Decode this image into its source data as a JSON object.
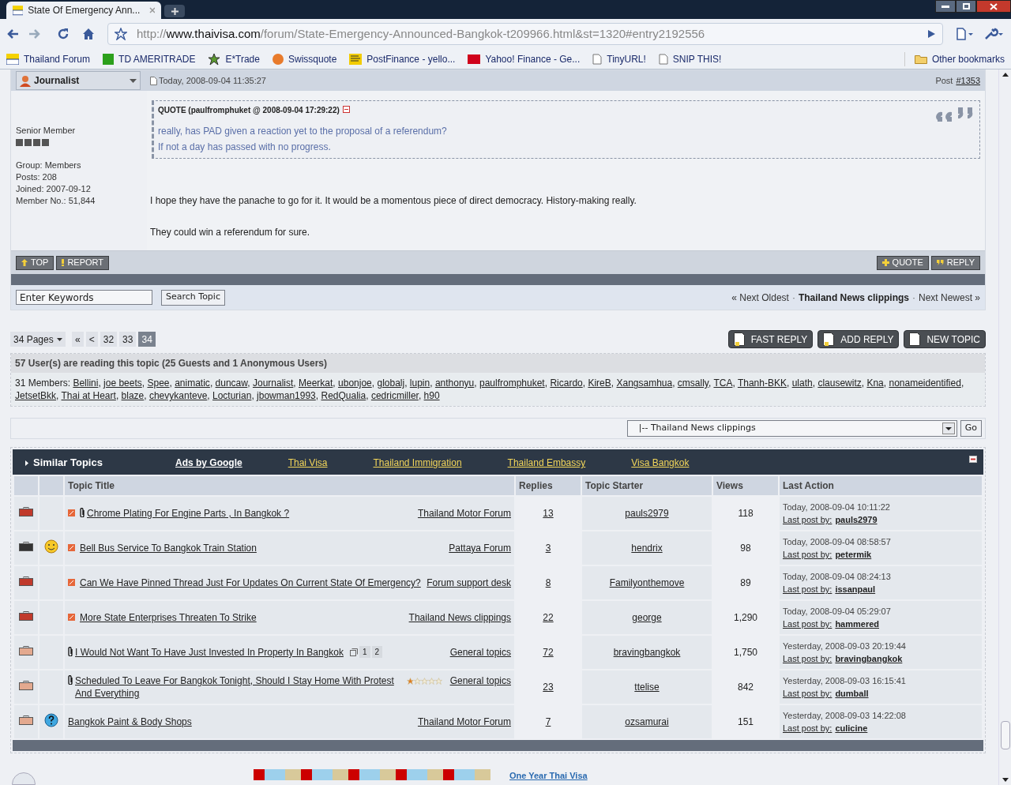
{
  "browser": {
    "tab_title": "State Of Emergency Ann...",
    "url": {
      "scheme": "http://",
      "host": "www.thaivisa.com",
      "path": "/forum/State-Emergency-Announced-Bangkok-t209966.html&st=1320#entry2192556"
    },
    "bookmarks": [
      {
        "label": "Thailand Forum",
        "kind": "flag"
      },
      {
        "label": "TD AMERITRADE",
        "kind": "td"
      },
      {
        "label": "E*Trade",
        "kind": "etrade"
      },
      {
        "label": "Swissquote",
        "kind": "swiss"
      },
      {
        "label": "PostFinance - yello...",
        "kind": "post"
      },
      {
        "label": "Yahoo! Finance - Ge...",
        "kind": "yahoo"
      },
      {
        "label": "TinyURL!",
        "kind": "page"
      },
      {
        "label": "SNIP THIS!",
        "kind": "page"
      }
    ],
    "other_bookmarks": "Other bookmarks"
  },
  "post": {
    "author": "Journalist",
    "date": "Today, 2008-09-04 11:35:27",
    "post_label": "Post",
    "post_number": "#1353",
    "member": {
      "rank": "Senior Member",
      "details": [
        "Group: Members",
        "Posts: 208",
        "Joined: 2007-09-12",
        "Member No.: 51,844"
      ]
    },
    "quote": {
      "header": "QUOTE (paulfromphuket @ 2008-09-04 17:29:22)",
      "lines": [
        "really, has PAD given a reaction yet to the proposal of a referendum?",
        "If not a day has passed with no progress."
      ]
    },
    "body": [
      "I hope they have the panache to go for it. It would be a momentous piece of direct democracy. History-making really.",
      "They could win a referendum for sure."
    ],
    "left_buttons": [
      "TOP",
      "REPORT"
    ],
    "right_buttons": [
      "QUOTE",
      "REPLY"
    ]
  },
  "search": {
    "value": "Enter Keywords",
    "button": "Search Topic"
  },
  "topic_nav": {
    "prev": "« Next Oldest",
    "separator_1": "·",
    "forum": "Thailand News clippings",
    "separator_2": "·",
    "next": "Next Newest »"
  },
  "pagination": {
    "label": "34 Pages",
    "items": [
      {
        "label": "«",
        "selected": false
      },
      {
        "label": "<",
        "selected": false
      },
      {
        "label": "32",
        "selected": false
      },
      {
        "label": "33",
        "selected": false
      },
      {
        "label": "34",
        "selected": true
      }
    ]
  },
  "action_buttons": [
    "FAST REPLY",
    "ADD REPLY",
    "NEW TOPIC"
  ],
  "readers": {
    "heading": "57 User(s) are reading this topic (25 Guests and 1 Anonymous Users)",
    "members_label": "31 Members:",
    "members": [
      {
        "name": "Bellini",
        "sep": ","
      },
      {
        "name": "joe beets",
        "sep": ","
      },
      {
        "name": "Spee",
        "sep": ","
      },
      {
        "name": "animatic",
        "sep": ","
      },
      {
        "name": "duncaw",
        "sep": ","
      },
      {
        "name": "Journalist",
        "sep": ","
      },
      {
        "name": "Meerkat",
        "sep": ","
      },
      {
        "name": "ubonjoe",
        "sep": ","
      },
      {
        "name": "globalj",
        "sep": ","
      },
      {
        "name": "lupin",
        "sep": ","
      },
      {
        "name": "anthonyu",
        "sep": ","
      },
      {
        "name": "paulfromphuket",
        "sep": ","
      },
      {
        "name": "Ricardo",
        "sep": ","
      },
      {
        "name": "KireB",
        "sep": ","
      },
      {
        "name": "Xangsamhua",
        "sep": ","
      },
      {
        "name": "cmsally",
        "sep": ","
      },
      {
        "name": "TCA",
        "sep": ","
      },
      {
        "name": "Thanh-BKK",
        "sep": ","
      },
      {
        "name": "ulath",
        "sep": ","
      },
      {
        "name": "clausewitz",
        "sep": ","
      },
      {
        "name": "Kna",
        "sep": ","
      },
      {
        "name": "nonameidentified",
        "sep": ","
      },
      {
        "name": "JetsetBkk",
        "sep": ","
      },
      {
        "name": "Thai at Heart",
        "sep": ","
      },
      {
        "name": "blaze",
        "sep": ","
      },
      {
        "name": "chevykanteve",
        "sep": ","
      },
      {
        "name": "Locturian",
        "sep": ","
      },
      {
        "name": "jbowman1993",
        "sep": ","
      },
      {
        "name": "RedQualia",
        "sep": ","
      },
      {
        "name": "cedricmiller",
        "sep": ","
      },
      {
        "name": "h90"
      }
    ]
  },
  "forum_jump": {
    "value": "|-- Thailand News clippings",
    "button": "Go"
  },
  "similar_topics": {
    "title": "Similar Topics",
    "links": [
      {
        "label": "Ads by Google",
        "kind": "label"
      },
      {
        "label": "Thai Visa",
        "kind": "link"
      },
      {
        "label": "Thailand Immigration",
        "kind": "link"
      },
      {
        "label": "Thailand Embassy",
        "kind": "link"
      },
      {
        "label": "Visa Bangkok",
        "kind": "link"
      }
    ],
    "columns": [
      "Topic Title",
      "Replies",
      "Topic Starter",
      "Views",
      "Last Action"
    ],
    "rows": [
      {
        "folder": {
          "kind": "hot"
        },
        "new": true,
        "attachment": true,
        "title": "Chrome Plating For Engine Parts , In Bangkok ?",
        "forum": "Thailand Motor Forum",
        "replies": "13",
        "starter": "pauls2979",
        "views": "118",
        "last_date": "Today, 2008-09-04 10:11:22",
        "last_label": "Last post by:",
        "last_by": "pauls2979"
      },
      {
        "folder": {
          "kind": "locked"
        },
        "emoticon": {
          "kind": "smile"
        },
        "new": true,
        "attachment": false,
        "title": "Bell Bus Service To Bangkok Train Station",
        "forum": "Pattaya Forum",
        "replies": "3",
        "starter": "hendrix",
        "views": "98",
        "last_date": "Today, 2008-09-04 08:58:57",
        "last_label": "Last post by:",
        "last_by": "petermik"
      },
      {
        "folder": {
          "kind": "hot"
        },
        "new": true,
        "attachment": false,
        "title": "Can We Have Pinned Thread Just For Updates On Current State Of Emergency?",
        "forum": "Forum support desk",
        "replies": "8",
        "starter": "Familyonthemove",
        "views": "89",
        "last_date": "Today, 2008-09-04 08:24:13",
        "last_label": "Last post by:",
        "last_by": "issanpaul"
      },
      {
        "folder": {
          "kind": "hot"
        },
        "new": true,
        "attachment": false,
        "title": "More State Enterprises Threaten To Strike",
        "forum": "Thailand News clippings",
        "replies": "22",
        "starter": "george",
        "views": "1,290",
        "last_date": "Today, 2008-09-04 05:29:07",
        "last_label": "Last post by:",
        "last_by": "hammered"
      },
      {
        "folder": {
          "kind": "read"
        },
        "new": false,
        "attachment": true,
        "title": "I Would Not Want To Have Just Invested In Property In Bangkok",
        "pages": [
          "1",
          "2"
        ],
        "forum": "General topics",
        "replies": "72",
        "starter": "bravingbangkok",
        "views": "1,750",
        "last_date": "Yesterday, 2008-09-03 20:19:44",
        "last_label": "Last post by:",
        "last_by": "bravingbangkok"
      },
      {
        "folder": {
          "kind": "read"
        },
        "new": false,
        "attachment": true,
        "title": "Scheduled To Leave For Bangkok Tonight, Should I Stay Home With Protest And Everything",
        "stars": 1,
        "forum": "General topics",
        "replies": "23",
        "starter": "ttelise",
        "views": "842",
        "last_date": "Yesterday, 2008-09-03 16:15:41",
        "last_label": "Last post by:",
        "last_by": "dumball"
      },
      {
        "folder": {
          "kind": "read"
        },
        "emoticon": {
          "kind": "question"
        },
        "new": false,
        "attachment": false,
        "title": "Bangkok Paint & Body Shops",
        "forum": "Thailand Motor Forum",
        "replies": "7",
        "starter": "ozsamurai",
        "views": "151",
        "last_date": "Yesterday, 2008-09-03 14:22:08",
        "last_label": "Last post by:",
        "last_by": "culicine"
      }
    ]
  },
  "footer": {
    "link": "One Year Thai Visa"
  }
}
